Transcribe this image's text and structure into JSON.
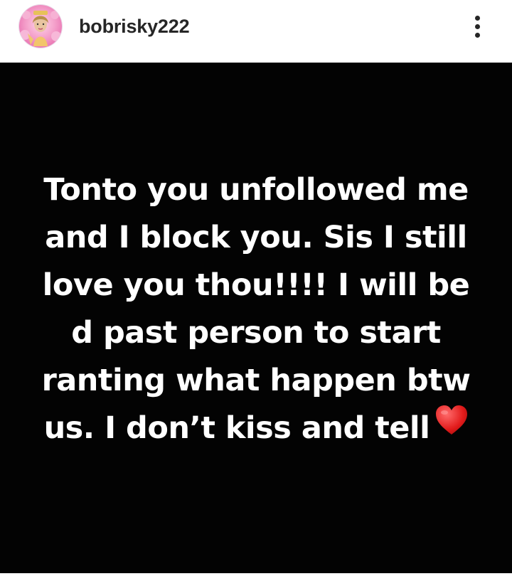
{
  "post": {
    "username": "bobrisky222",
    "avatar_icon": "profile-avatar-icon",
    "more_icon": "more-vertical-icon",
    "caption_lines": [
      "Tonto you unfollowed me",
      "and I block you. Sis I still",
      "love you thou!!!!  I will be",
      "d past person to start",
      "ranting what happen btw",
      "us. I don’t kiss and tell"
    ],
    "caption_emoji_icon": "red-heart-icon"
  },
  "colors": {
    "post_background": "#030303",
    "text": "#ffffff",
    "username": "#262626"
  }
}
